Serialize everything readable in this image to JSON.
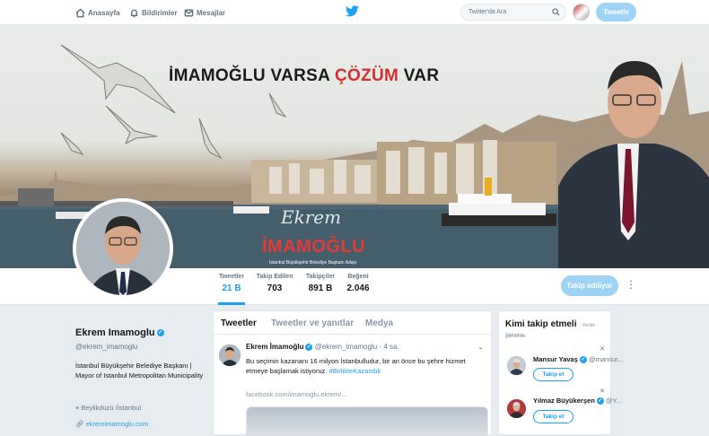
{
  "nav": {
    "home": "Anasayfa",
    "notifications": "Bildirimler",
    "messages": "Mesajlar",
    "search_placeholder": "Twitter'da Ara",
    "tweet_button": "Tweetle"
  },
  "banner": {
    "title_part1": "İMAMOĞLU VARSA ",
    "title_accent": "ÇÖZÜM",
    "title_part2": " VAR",
    "signature_script": "Ekrem",
    "signature_name": "İMAMOĞLU",
    "signature_sub": "İstanbul Büyükşehir Belediye Başkanı Adayı"
  },
  "stats": [
    {
      "label": "Tweetler",
      "value": "21 B"
    },
    {
      "label": "Takip Edilen",
      "value": "703"
    },
    {
      "label": "Takipçiler",
      "value": "891 B"
    },
    {
      "label": "Beğeni",
      "value": "2.046"
    }
  ],
  "profile": {
    "follow_button": "Takip ediliyor",
    "name": "Ekrem Imamoglu",
    "handle": "@ekrem_imamoglu",
    "bio": "İstanbul Büyükşehir Belediye Başkanı | Mayor of Istanbul Metropolitan Municipality",
    "location": "Beylikdüzü /İstanbul",
    "website": "ekremimamoglu.com"
  },
  "timeline": {
    "tabs": [
      "Tweetler",
      "Tweetler ve yanıtlar",
      "Medya"
    ],
    "tweet": {
      "name": "Ekrem İmamoğlu",
      "handle": "@ekrem_imamoglu",
      "time": "· 4 sa.",
      "text": "Bu seçimin kazananı 16 milyon İstanbulludur, bir an önce bu şehre hizmet etmeye başlamak istiyoruz.",
      "hashtag": "#BirlikteKazandık",
      "url": "facebook.com/imamoglu.ekrem/..."
    }
  },
  "who_to_follow": {
    "title": "Kimi takip etmeli",
    "subtitle": "· Yenile · Tümünü",
    "subtitle2": "görüntüle",
    "suggestions": [
      {
        "name": "Mansur Yavaş",
        "handle": "@mansur...",
        "button": "Takip et"
      },
      {
        "name": "Yılmaz Büyükerşen",
        "handle": "@Y...",
        "button": "Takip et"
      }
    ]
  },
  "colors": {
    "accent": "#1da1f2",
    "banner_red": "#d32f2f",
    "button_disabled": "#9fd3f5"
  }
}
